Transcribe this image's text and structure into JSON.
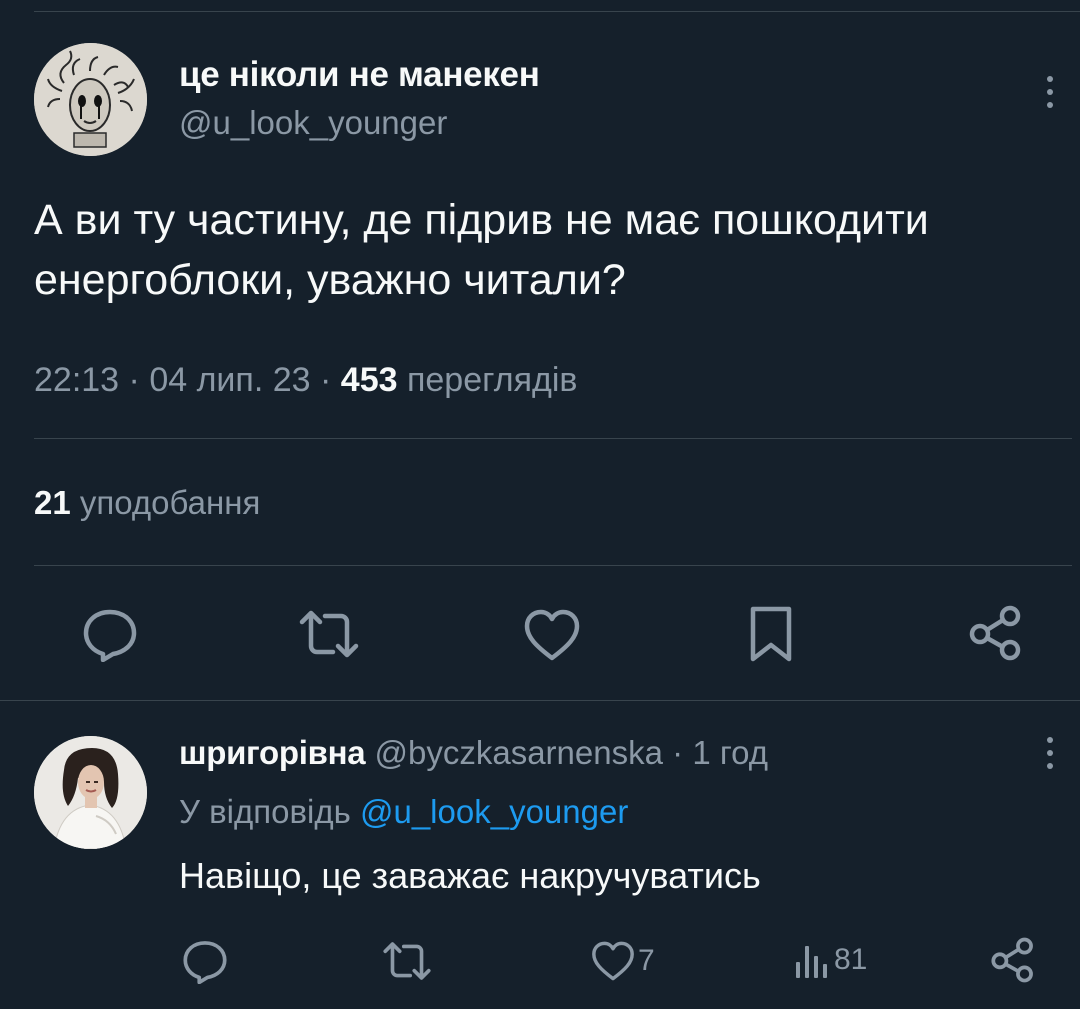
{
  "main_tweet": {
    "display_name": "це ніколи не манекен",
    "handle": "@u_look_younger",
    "text": "А ви ту частину, де підрив не має пошкодити енергоблоки, уважно читали?",
    "time": "22:13",
    "date": "04 лип. 23",
    "views_count": "453",
    "views_label": "переглядів",
    "likes_count": "21",
    "likes_label": "уподобання",
    "actions": [
      "reply-icon",
      "retweet-icon",
      "like-icon",
      "bookmark-icon",
      "share-icon"
    ]
  },
  "reply": {
    "display_name": "шригорівна",
    "handle": "@byczkasarnenska",
    "time": "1 год",
    "reply_to_label": "У відповідь",
    "reply_to_handle": "@u_look_younger",
    "text": "Навіщо, це заважає накручуватись",
    "likes": "7",
    "views": "81",
    "actions": [
      "reply-icon",
      "retweet-icon",
      "like-icon",
      "views-icon",
      "share-icon"
    ]
  },
  "colors": {
    "background": "#15202b",
    "text": "#f7f9f9",
    "muted": "#8b98a5",
    "accent": "#1d9bf0",
    "divider": "#38444d"
  }
}
